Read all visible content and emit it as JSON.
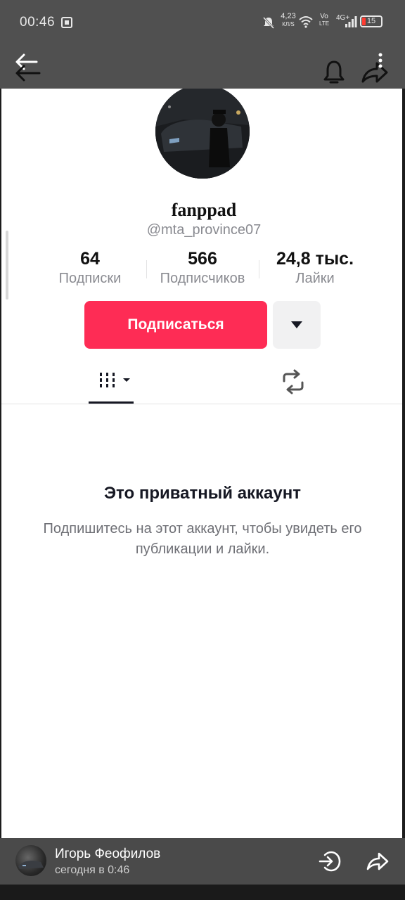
{
  "status_bar": {
    "time": "00:46",
    "net_speed": "4,23",
    "net_unit": "КЛ/S",
    "volte_top": "Vo",
    "volte_bottom": "LTE",
    "signal_label": "4G+",
    "battery": "15"
  },
  "profile": {
    "username": "fanppad",
    "handle": "@mta_province07",
    "stats": [
      {
        "value": "64",
        "label": "Подписки"
      },
      {
        "value": "566",
        "label": "Подписчиков"
      },
      {
        "value": "24,8 тыс.",
        "label": "Лайки"
      }
    ],
    "follow_label": "Подписаться"
  },
  "private": {
    "title": "Это приватный аккаунт",
    "description": "Подпишитесь на этот аккаунт, чтобы увидеть его публикации и лайки."
  },
  "message": {
    "sender": "Игорь Феофилов",
    "time": "сегодня в 0:46"
  },
  "colors": {
    "accent": "#fe2c55",
    "overlay": "#505050"
  },
  "icons": [
    "back-arrow-icon",
    "bell-icon",
    "share-icon",
    "more-vertical-icon",
    "grid-icon",
    "repost-icon",
    "reply-icon",
    "forward-icon"
  ]
}
